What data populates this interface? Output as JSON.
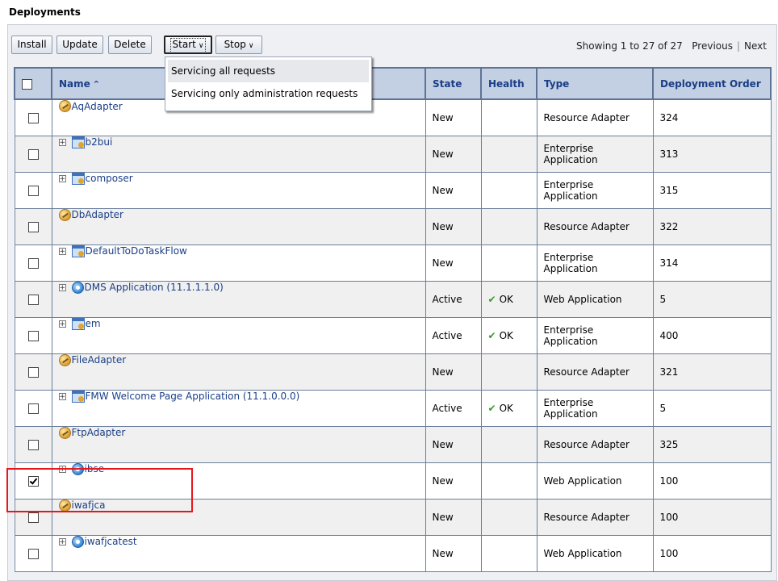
{
  "page_title": "Deployments",
  "toolbar": {
    "install": "Install",
    "update": "Update",
    "delete": "Delete",
    "start": "Start",
    "stop": "Stop"
  },
  "pager": {
    "showing": "Showing 1 to 27 of 27",
    "previous": "Previous",
    "next": "Next"
  },
  "start_menu": {
    "items": [
      "Servicing all requests",
      "Servicing only administration requests"
    ]
  },
  "table": {
    "headers": {
      "name": "Name",
      "state": "State",
      "health": "Health",
      "type": "Type",
      "order": "Deployment Order"
    },
    "rows": [
      {
        "checked": false,
        "expandable": false,
        "icon": "adapter-icon",
        "name": "AqAdapter",
        "state": "New",
        "health": "",
        "type": "Resource Adapter",
        "order": "324"
      },
      {
        "checked": false,
        "expandable": true,
        "icon": "enterprise-app-icon",
        "name": "b2bui",
        "state": "New",
        "health": "",
        "type": "Enterprise Application",
        "order": "313"
      },
      {
        "checked": false,
        "expandable": true,
        "icon": "enterprise-app-icon",
        "name": "composer",
        "state": "New",
        "health": "",
        "type": "Enterprise Application",
        "order": "315"
      },
      {
        "checked": false,
        "expandable": false,
        "icon": "adapter-icon",
        "name": "DbAdapter",
        "state": "New",
        "health": "",
        "type": "Resource Adapter",
        "order": "322"
      },
      {
        "checked": false,
        "expandable": true,
        "icon": "enterprise-app-icon",
        "name": "DefaultToDoTaskFlow",
        "state": "New",
        "health": "",
        "type": "Enterprise Application",
        "order": "314"
      },
      {
        "checked": false,
        "expandable": true,
        "icon": "web-app-icon",
        "name": "DMS Application (11.1.1.1.0)",
        "state": "Active",
        "health": "OK",
        "type": "Web Application",
        "order": "5"
      },
      {
        "checked": false,
        "expandable": true,
        "icon": "enterprise-app-icon",
        "name": "em",
        "state": "Active",
        "health": "OK",
        "type": "Enterprise Application",
        "order": "400"
      },
      {
        "checked": false,
        "expandable": false,
        "icon": "adapter-icon",
        "name": "FileAdapter",
        "state": "New",
        "health": "",
        "type": "Resource Adapter",
        "order": "321"
      },
      {
        "checked": false,
        "expandable": true,
        "icon": "enterprise-app-icon",
        "name": "FMW Welcome Page Application (11.1.0.0.0)",
        "state": "Active",
        "health": "OK",
        "type": "Enterprise Application",
        "order": "5"
      },
      {
        "checked": false,
        "expandable": false,
        "icon": "adapter-icon",
        "name": "FtpAdapter",
        "state": "New",
        "health": "",
        "type": "Resource Adapter",
        "order": "325"
      },
      {
        "checked": true,
        "expandable": true,
        "icon": "web-app-icon",
        "name": "ibse",
        "state": "New",
        "health": "",
        "type": "Web Application",
        "order": "100"
      },
      {
        "checked": false,
        "expandable": false,
        "icon": "adapter-icon",
        "name": "iwafjca",
        "state": "New",
        "health": "",
        "type": "Resource Adapter",
        "order": "100"
      },
      {
        "checked": false,
        "expandable": true,
        "icon": "web-app-icon",
        "name": "iwafjcatest",
        "state": "New",
        "health": "",
        "type": "Web Application",
        "order": "100"
      }
    ]
  }
}
